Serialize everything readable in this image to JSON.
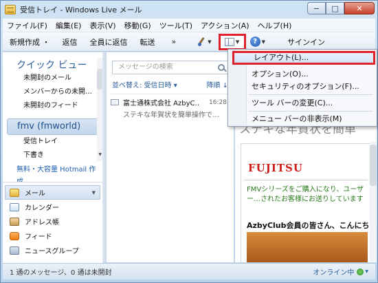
{
  "window": {
    "title": "受信トレイ - Windows Live メール",
    "caption": {
      "minimize": "−",
      "maximize": "□",
      "close": "✕"
    }
  },
  "menubar": [
    "ファイル(F)",
    "編集(E)",
    "表示(V)",
    "移動(G)",
    "ツール(T)",
    "アクション(A)",
    "ヘルプ(H)"
  ],
  "toolbar": {
    "new": "新規作成 ・",
    "reply": "返信",
    "reply_all": "全員に返信",
    "forward": "転送",
    "more": "»",
    "signin": "サインイン"
  },
  "nav": {
    "quick_view_title": "クイック ビュー",
    "quick_view_items": [
      "未開封のメール",
      "メンバーからの未開…",
      "未開封のフィード"
    ],
    "account": "fmv (fmworld)",
    "account_items": [
      "受信トレイ",
      "下書き"
    ],
    "promo": "無料・大容量 Hotmail 作成"
  },
  "apps": [
    {
      "label": "メール",
      "icon": "mail-icon",
      "selected": true
    },
    {
      "label": "カレンダー",
      "icon": "calendar-icon",
      "selected": false
    },
    {
      "label": "アドレス帳",
      "icon": "address-book-icon",
      "selected": false
    },
    {
      "label": "フィード",
      "icon": "feed-icon",
      "selected": false
    },
    {
      "label": "ニュースグループ",
      "icon": "newsgroup-icon",
      "selected": false
    }
  ],
  "message_list": {
    "search_placeholder": "メッセージの検索",
    "sort_label": "並べ替え: 受信日時 ▾",
    "sort_direction": "降順 ↓",
    "messages": [
      {
        "from": "富士通株式会社 AzbyC…",
        "time": "16:28",
        "subject": "ステキな年賀状を簡単操作で…"
      }
    ]
  },
  "reading_pane": {
    "peek_title": "ステキな年賀状を簡単",
    "brand": "FUJITSU",
    "body_green": "FMVシリーズをご購入になり、ユーザー…されたお客様にお送りしています",
    "heading": "AzbyClub会員の皆さん、こんにち"
  },
  "status": {
    "left": "1 通のメッセージ、0 通は未開封",
    "right": "オンライン中"
  },
  "dropdown_menu": {
    "items": [
      {
        "label": "レイアウト(L)...",
        "highlighted": true
      },
      {
        "label": "オプション(O)...",
        "highlighted": false
      },
      {
        "label": "セキュリティのオプション(F)...",
        "highlighted": false
      },
      {
        "label": "ツール バーの変更(C)...",
        "highlighted": false
      },
      {
        "label": "メニュー バーの非表示(M)",
        "highlighted": false
      }
    ]
  },
  "colors": {
    "accent_red": "#e0202a",
    "link_blue": "#2a5d9e",
    "brand_red": "#d11b1b",
    "green_text": "#2a7a1c"
  }
}
